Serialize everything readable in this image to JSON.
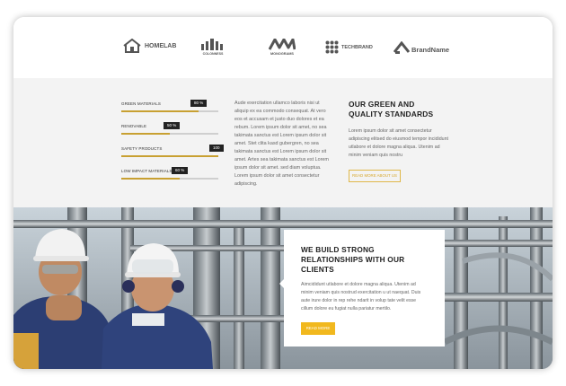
{
  "logos": [
    {
      "name": "HOMELAB",
      "icon": "house-icon"
    },
    {
      "name": "COLONNESS",
      "icon": "columns-icon"
    },
    {
      "name": "MONOGRAMS",
      "icon": "monogram-icon"
    },
    {
      "name": "TECHBRAND",
      "icon": "dots-grid-icon"
    },
    {
      "name": "BrandName",
      "icon": "roof-icon"
    }
  ],
  "skills": [
    {
      "label": "GREEN MATERIALS",
      "percent": "80 %",
      "value": 0.8
    },
    {
      "label": "RENOVABLE",
      "percent": "50 %",
      "value": 0.5
    },
    {
      "label": "SAFETY PRODUCTS",
      "percent": "100 %",
      "value": 1.0
    },
    {
      "label": "LOW IMPACT MATERIALS",
      "percent": "60 %",
      "value": 0.6
    }
  ],
  "middle_text": "Aude exercitation ullamco laboris nisi ut aliquip ex ea commodo consequat. At vero eos et accusam et justo duo dolores et ea rebum. Lorem ipsum dolor sit amet, no sea takimata sanctus est Lorem ipsum dolor sit amet. Stet clita kasd gubergren, no sea takimata sanctus est Lorem ipsum dolor sit amet. Artes sea takimata sanctus est Lorem ipsum dolor sit amet. sed diam voluptua. Lorem ipsum dolor sit amet consectetur adipiscing.",
  "quality": {
    "title": "OUR GREEN AND QUALITY STANDARDS",
    "text": "Lorem ipsum dolor sit amet consectetur adipiscing elitsed do eiusmod tempor incididunt utlabore et dolore magna aliqua. Utenim ad minim veniam quis nostru",
    "button": "READ MORE ABOUT US"
  },
  "card": {
    "title": "WE BUILD STRONG RELATIONSHIPS WITH OUR CLIENTS",
    "text": "Aimcididunt utlabore et dolore magna aliqua. Utenim ad minim veniam quis nostrud exercitation u ut naequat. Duis aute irure dolor in rep rehe ndarit in volup tate velit esse cillum dolore eu fugiat nulla pariatur mertilo.",
    "button": "READ MORE"
  },
  "colors": {
    "accent": "#f1b81e",
    "bar_fill": "#c8a032",
    "section_bg": "#f3f3f3"
  }
}
